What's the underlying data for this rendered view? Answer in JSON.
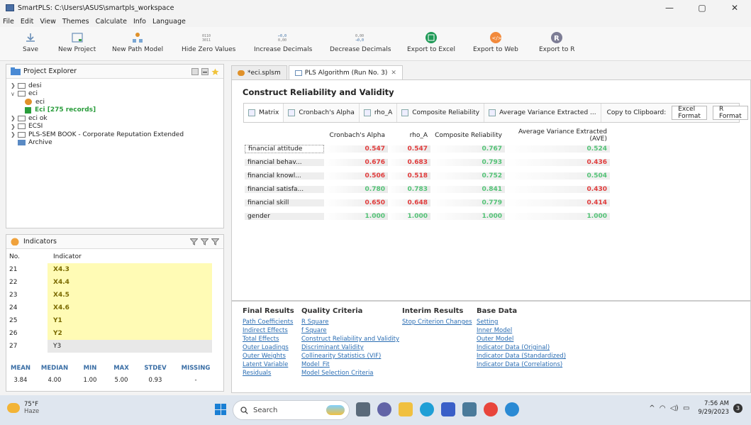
{
  "window": {
    "title": "SmartPLS: C:\\Users\\ASUS\\smartpls_workspace",
    "controls": [
      "—",
      "▢",
      "✕"
    ]
  },
  "menu": [
    "File",
    "Edit",
    "View",
    "Themes",
    "Calculate",
    "Info",
    "Language"
  ],
  "toolbar": {
    "save": "Save",
    "new_project": "New Project",
    "new_path_model": "New Path Model",
    "hide_zero_values": "Hide Zero Values",
    "increase_decimals": "Increase Decimals",
    "decrease_decimals": "Decrease Decimals",
    "export_excel": "Export to Excel",
    "export_web": "Export to Web",
    "export_r": "Export to R"
  },
  "project_explorer": {
    "title": "Project Explorer",
    "items": [
      {
        "label": "desi"
      },
      {
        "label": "eci"
      },
      {
        "label": "eci"
      },
      {
        "label": "Eci [275 records]"
      },
      {
        "label": "eci ok"
      },
      {
        "label": "ECSI"
      },
      {
        "label": "PLS-SEM BOOK - Corporate Reputation Extended"
      },
      {
        "label": "Archive"
      }
    ]
  },
  "indicators": {
    "title": "Indicators",
    "header_no": "No.",
    "header_indicator": "Indicator",
    "rows": [
      {
        "no": "21",
        "name": "X4.3"
      },
      {
        "no": "22",
        "name": "X4.4"
      },
      {
        "no": "23",
        "name": "X4.5"
      },
      {
        "no": "24",
        "name": "X4.6"
      },
      {
        "no": "25",
        "name": "Y1"
      },
      {
        "no": "26",
        "name": "Y2"
      },
      {
        "no": "27",
        "name": "Y3"
      }
    ],
    "stats_headers": [
      "MEAN",
      "MEDIAN",
      "MIN",
      "MAX",
      "STDEV",
      "MISSING"
    ],
    "stats_values": [
      "3.84",
      "4.00",
      "1.00",
      "5.00",
      "0.93",
      "-"
    ]
  },
  "editor": {
    "tabs": [
      "*eci.splsm",
      "PLS Algorithm (Run No. 3)"
    ],
    "tab_close": "✕",
    "section_title": "Construct Reliability and Validity",
    "subtabs": [
      "Matrix",
      "Cronbach's Alpha",
      "rho_A",
      "Composite Reliability",
      "Average Variance Extracted ..."
    ],
    "copy_label": "Copy to Clipboard:",
    "excel_format": "Excel Format",
    "r_format": "R Format",
    "columns": [
      "Cronbach's Alpha",
      "rho_A",
      "Composite Reliability",
      "Average Variance Extracted (AVE)"
    ],
    "rows": [
      {
        "name": "financial attitude",
        "v": [
          "0.547",
          "0.547",
          "0.767",
          "0.524"
        ],
        "c": [
          "red",
          "red",
          "grn",
          "grn"
        ]
      },
      {
        "name": "financial behav...",
        "v": [
          "0.676",
          "0.683",
          "0.793",
          "0.436"
        ],
        "c": [
          "red",
          "red",
          "grn",
          "red"
        ]
      },
      {
        "name": "financial knowl...",
        "v": [
          "0.506",
          "0.518",
          "0.752",
          "0.504"
        ],
        "c": [
          "red",
          "red",
          "grn",
          "grn"
        ]
      },
      {
        "name": "financial satisfa...",
        "v": [
          "0.780",
          "0.783",
          "0.841",
          "0.430"
        ],
        "c": [
          "grn",
          "grn",
          "grn",
          "red"
        ]
      },
      {
        "name": "financial skill",
        "v": [
          "0.650",
          "0.648",
          "0.779",
          "0.414"
        ],
        "c": [
          "red",
          "red",
          "grn",
          "red"
        ]
      },
      {
        "name": "gender",
        "v": [
          "1.000",
          "1.000",
          "1.000",
          "1.000"
        ],
        "c": [
          "grn",
          "grn",
          "grn",
          "grn"
        ]
      }
    ]
  },
  "links": {
    "final_results": {
      "title": "Final Results",
      "items": [
        "Path Coefficients",
        "Indirect Effects",
        "Total Effects",
        "Outer Loadings",
        "Outer Weights",
        "Latent Variable",
        "Residuals"
      ]
    },
    "quality_criteria": {
      "title": "Quality Criteria",
      "items": [
        "R Square",
        "f Square",
        "Construct Reliability and Validity",
        "Discriminant Validity",
        "Collinearity Statistics (VIF)",
        "Model_Fit",
        "Model Selection Criteria"
      ]
    },
    "interim_results": {
      "title": "Interim Results",
      "items": [
        "Stop Criterion Changes"
      ]
    },
    "base_data": {
      "title": "Base Data",
      "items": [
        "Setting",
        "Inner Model",
        "Outer Model",
        "Indicator Data (Original)",
        "Indicator Data (Standardized)",
        "Indicator Data (Correlations)"
      ]
    }
  },
  "taskbar": {
    "weather_temp": "75°F",
    "weather_desc": "Haze",
    "search_placeholder": "Search",
    "time": "7:56 AM",
    "date": "9/29/2023",
    "notifications": "3",
    "colors": {
      "accent": "#1a7fd4",
      "red_value": "#e03b3b",
      "green_value": "#53c276",
      "indicator_highlight": "#fffbb5"
    }
  }
}
